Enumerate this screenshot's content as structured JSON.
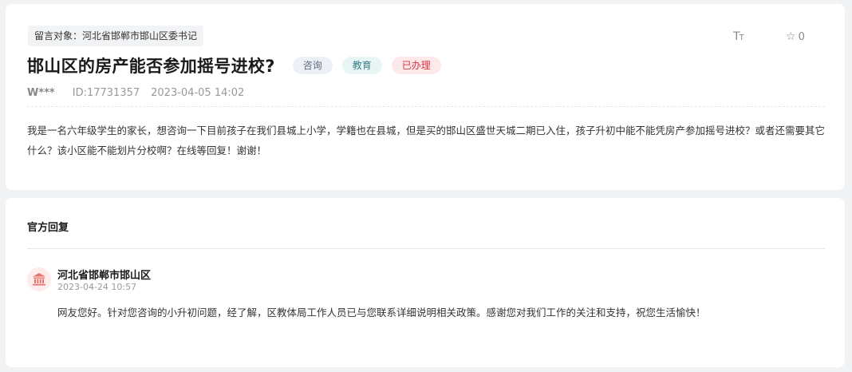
{
  "message": {
    "target_label": "留言对象：河北省邯郸市邯山区委书记",
    "title": "邯山区的房产能否参加摇号进校?",
    "tags": [
      "咨询",
      "教育",
      "已办理"
    ],
    "user": "W***",
    "id": "ID:17731357",
    "datetime": "2023-04-05 14:02",
    "content": "我是一名六年级学生的家长，想咨询一下目前孩子在我们县城上小学，学籍也在县城，但是买的邯山区盛世天城二期已入住，孩子升初中能不能凭房产参加摇号进校？或者还需要其它什么？该小区能不能划片分校啊？在线等回复！谢谢！"
  },
  "toolbar": {
    "font_icon": "font-size-icon",
    "star_icon": "star-icon",
    "star_count": "0"
  },
  "reply": {
    "heading": "官方回复",
    "org_icon": "government-building-icon",
    "org_name": "河北省邯郸市邯山区",
    "datetime": "2023-04-24 10:57",
    "content": "网友您好。针对您咨询的小升初问题，经了解，区教体局工作人员已与您联系详细说明相关政策。感谢您对我们工作的关注和支持，祝您生活愉快！"
  },
  "colors": {
    "tag_consult": "#5f6b80",
    "tag_education": "#3d7d86",
    "tag_done": "#d9323f"
  }
}
